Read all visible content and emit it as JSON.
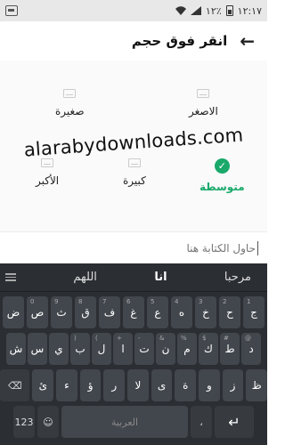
{
  "status": {
    "time": "١٢:١٧",
    "battery": "٪١٢"
  },
  "header": {
    "title": "انقر فوق حجم",
    "back": "←"
  },
  "options": [
    {
      "label": "الاصغر",
      "selected": false
    },
    {
      "label": "صغيرة",
      "selected": false
    },
    {
      "label": "متوسطة",
      "selected": true
    },
    {
      "label": "كبيرة",
      "selected": false
    },
    {
      "label": "الأكبر",
      "selected": false
    }
  ],
  "watermark": "alarabydownloads.com",
  "input": {
    "placeholder": "حاول الكتابة هنا"
  },
  "keyboard": {
    "suggestions": [
      "مرحبا",
      "انا",
      "اللهم"
    ],
    "row1": [
      {
        "k": "ج",
        "h": "1"
      },
      {
        "k": "ح",
        "h": "2"
      },
      {
        "k": "خ",
        "h": "3"
      },
      {
        "k": "ه",
        "h": "4"
      },
      {
        "k": "ع",
        "h": "5"
      },
      {
        "k": "غ",
        "h": "6"
      },
      {
        "k": "ف",
        "h": "7"
      },
      {
        "k": "ق",
        "h": "8"
      },
      {
        "k": "ث",
        "h": "9"
      },
      {
        "k": "ص",
        "h": "0"
      },
      {
        "k": "ض",
        "h": ""
      }
    ],
    "row2": [
      {
        "k": "د",
        "h": "@"
      },
      {
        "k": "ط",
        "h": "#"
      },
      {
        "k": "ك",
        "h": "$"
      },
      {
        "k": "م",
        "h": "%"
      },
      {
        "k": "ن",
        "h": "&"
      },
      {
        "k": "ت",
        "h": "-"
      },
      {
        "k": "ا",
        "h": "+"
      },
      {
        "k": "ل",
        "h": "("
      },
      {
        "k": "ب",
        "h": ")"
      },
      {
        "k": "ي",
        "h": ""
      },
      {
        "k": "س",
        "h": ""
      },
      {
        "k": "ش",
        "h": ""
      }
    ],
    "row3": [
      {
        "k": "ظ",
        "h": ""
      },
      {
        "k": "ز",
        "h": ""
      },
      {
        "k": "و",
        "h": ""
      },
      {
        "k": "ة",
        "h": ""
      },
      {
        "k": "ى",
        "h": ""
      },
      {
        "k": "لا",
        "h": ""
      },
      {
        "k": "ر",
        "h": ""
      },
      {
        "k": "ؤ",
        "h": ""
      },
      {
        "k": "ء",
        "h": ""
      },
      {
        "k": "ئ",
        "h": ""
      }
    ],
    "backspace": "⌫",
    "num_key": "123",
    "emoji_key": "☺",
    "space_label": "العربية",
    "dot_key": "،",
    "enter_key": "↵"
  }
}
